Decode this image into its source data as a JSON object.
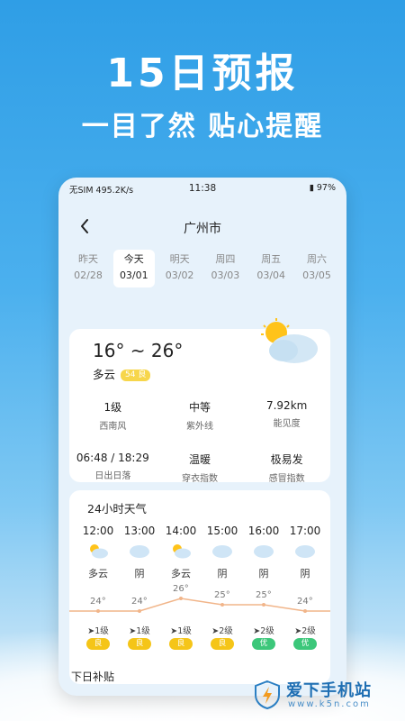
{
  "promo": {
    "title": "15日预报",
    "subtitle": "一目了然 贴心提醒"
  },
  "statusbar": {
    "left": "无SIM 495.2K/s",
    "time": "11:38",
    "battery": "97%"
  },
  "header": {
    "city": "广州市"
  },
  "days": [
    {
      "name": "昨天",
      "date": "02/28",
      "active": false
    },
    {
      "name": "今天",
      "date": "03/01",
      "active": true
    },
    {
      "name": "明天",
      "date": "03/02",
      "active": false
    },
    {
      "name": "周四",
      "date": "03/03",
      "active": false
    },
    {
      "name": "周五",
      "date": "03/04",
      "active": false
    },
    {
      "name": "周六",
      "date": "03/05",
      "active": false
    }
  ],
  "today": {
    "temp_range": "16° ~ 26°",
    "condition": "多云",
    "aqi_label": "54 良",
    "icon": "partly-cloudy-icon",
    "stats": [
      {
        "value": "1级",
        "label": "西南风"
      },
      {
        "value": "中等",
        "label": "紫外线"
      },
      {
        "value": "7.92km",
        "label": "能见度"
      },
      {
        "value": "06:48 / 18:29",
        "label": "日出日落"
      },
      {
        "value": "温暖",
        "label": "穿衣指数"
      },
      {
        "value": "极易发",
        "label": "感冒指数"
      }
    ]
  },
  "hourly": {
    "title": "24小时天气",
    "items": [
      {
        "time": "12:00",
        "condition": "多云",
        "icon": "partly-cloudy-icon",
        "temp": "24°",
        "wind": "1级",
        "aqi": "良",
        "aqi_color": "#f5c518"
      },
      {
        "time": "13:00",
        "condition": "阴",
        "icon": "cloudy-icon",
        "temp": "24°",
        "wind": "1级",
        "aqi": "良",
        "aqi_color": "#f5c518"
      },
      {
        "time": "14:00",
        "condition": "多云",
        "icon": "partly-cloudy-icon",
        "temp": "26°",
        "wind": "1级",
        "aqi": "良",
        "aqi_color": "#f5c518"
      },
      {
        "time": "15:00",
        "condition": "阴",
        "icon": "cloudy-icon",
        "temp": "25°",
        "wind": "2级",
        "aqi": "良",
        "aqi_color": "#f5c518"
      },
      {
        "time": "16:00",
        "condition": "阴",
        "icon": "cloudy-icon",
        "temp": "25°",
        "wind": "2级",
        "aqi": "优",
        "aqi_color": "#3cc77a"
      },
      {
        "time": "17:00",
        "condition": "阴",
        "icon": "cloudy-icon",
        "temp": "24°",
        "wind": "2级",
        "aqi": "优",
        "aqi_color": "#3cc77a"
      }
    ]
  },
  "next_section_title": "下日补贴",
  "watermark": {
    "name": "爱下手机站",
    "url": "www.k5n.com"
  }
}
